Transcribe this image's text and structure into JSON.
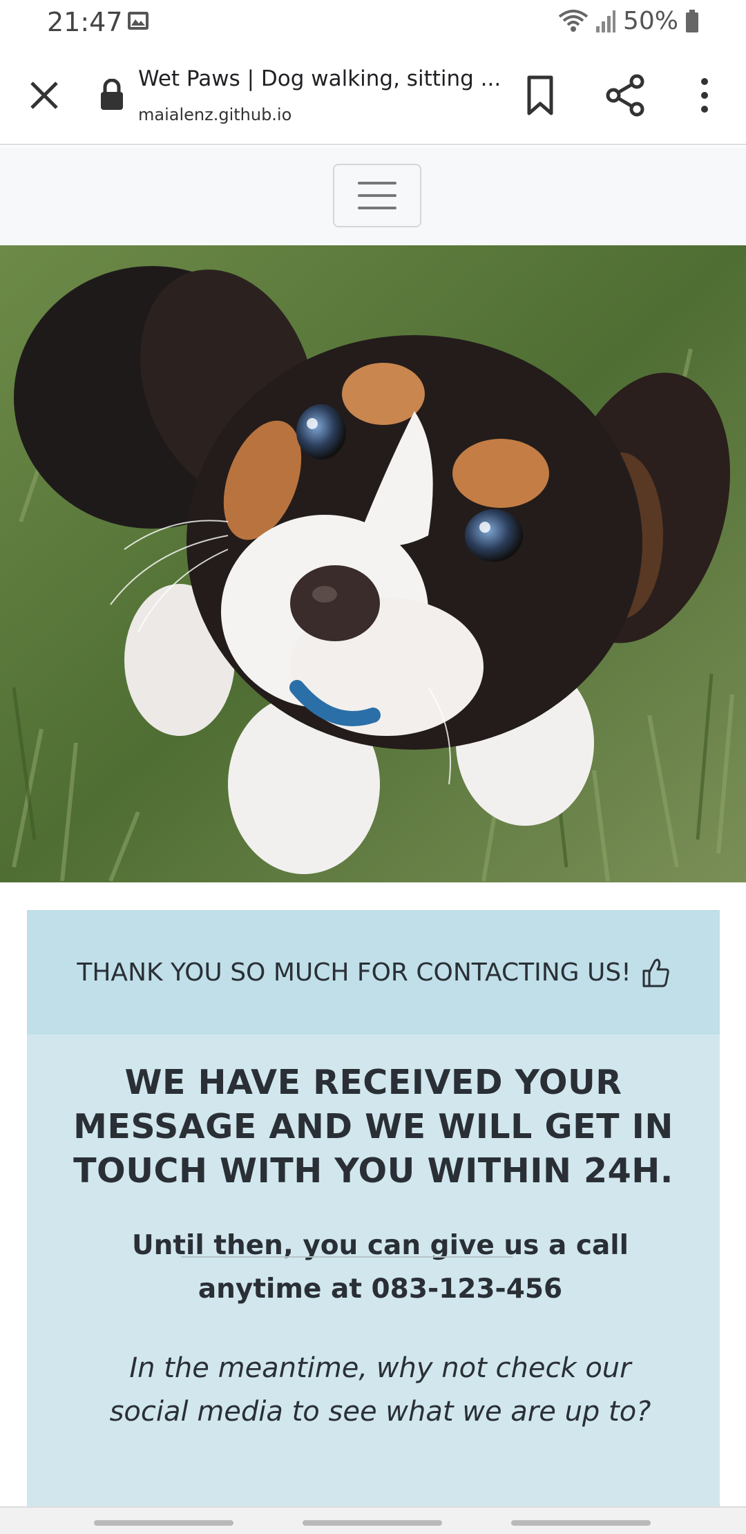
{
  "status_bar": {
    "time": "21:47",
    "battery": "50%",
    "icons": [
      "image-icon",
      "wifi-icon",
      "signal-icon",
      "battery-icon"
    ]
  },
  "browser": {
    "page_title": "Wet Paws | Dog walking, sitting ...",
    "url": "maialenz.github.io",
    "icons": [
      "close-icon",
      "lock-icon",
      "bookmark-icon",
      "share-icon",
      "more-vert-icon"
    ]
  },
  "site_nav": {
    "toggler_icon": "hamburger-icon"
  },
  "hero": {
    "subject": "puppy photo"
  },
  "card": {
    "header": "THANK YOU SO MUCH FOR CONTACTING US!",
    "header_icon": "thumbs-up-icon",
    "heading_line1": "WE HAVE RECEIVED YOUR",
    "heading_line2": "MESSAGE AND WE WILL GET IN",
    "heading_line3": "TOUCH WITH YOU WITHIN 24H.",
    "call_line1": "Until then, you can give us a call",
    "call_line2": "anytime at 083-123-456",
    "social_line1": "In the meantime, why not check our",
    "social_line2": "social media to see what we are up to?"
  },
  "colors": {
    "card_body": "#d1e7ed",
    "card_header": "#c0dfe8",
    "text": "#2a2f36"
  }
}
